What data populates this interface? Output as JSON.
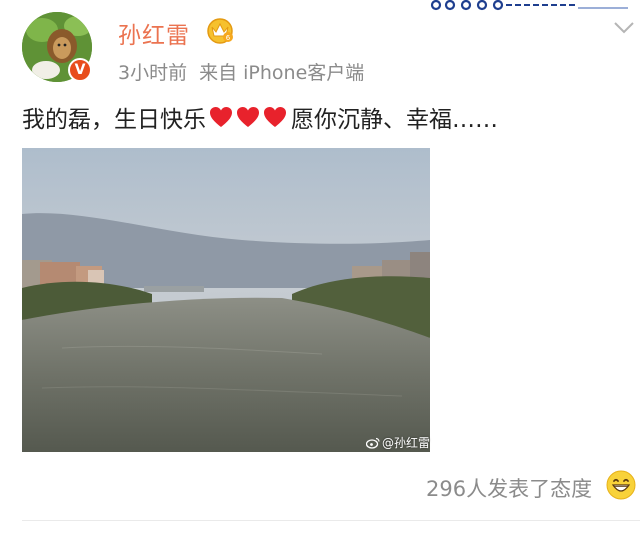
{
  "post": {
    "username": "孙红雷",
    "time": "3小时前",
    "source": "来自 iPhone客户端",
    "text_before_hearts": "我的磊，生日快乐",
    "hearts_count": 3,
    "text_after_hearts": "愿你沉静、幸福……",
    "photo_watermark": "@孙红雷",
    "reactions": "296人发表了态度"
  },
  "colors": {
    "username": "#eb7350",
    "meta": "#8b8b8b",
    "heart": "#e8222c",
    "verified_badge": "#e84d1c"
  },
  "icons": {
    "verified": "verified-v-icon",
    "member": "vip-crown-icon",
    "menu": "chevron-down-icon",
    "reaction": "grin-emoji-icon",
    "weibo": "weibo-logo-icon"
  }
}
